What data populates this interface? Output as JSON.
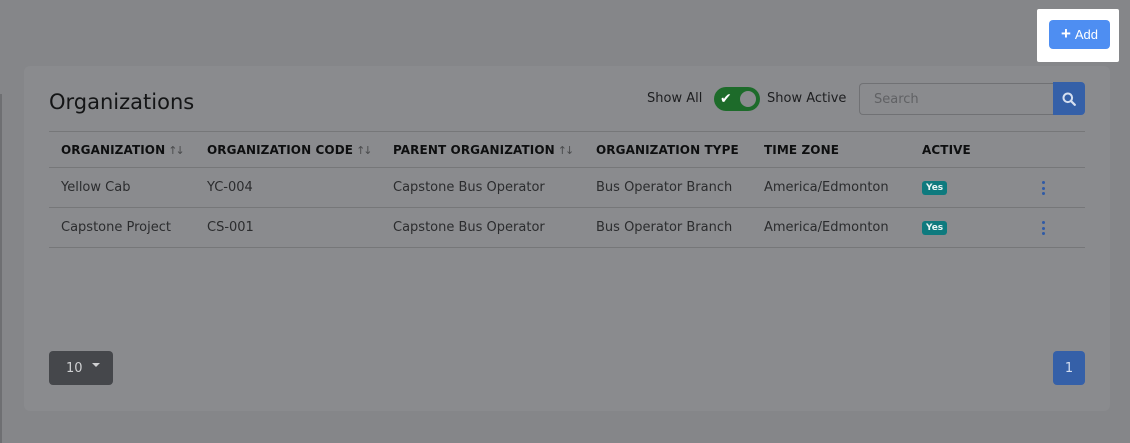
{
  "header": {
    "add_label": "Add",
    "add_icon": "plus-icon"
  },
  "card": {
    "title": "Organizations",
    "show_all_label": "Show All",
    "show_active_label": "Show Active",
    "toggle_on": true,
    "search_placeholder": "Search",
    "search_value": ""
  },
  "table": {
    "columns": [
      {
        "label": "ORGANIZATION",
        "sortable": true
      },
      {
        "label": "ORGANIZATION CODE",
        "sortable": true
      },
      {
        "label": "PARENT ORGANIZATION",
        "sortable": true
      },
      {
        "label": "ORGANIZATION TYPE",
        "sortable": false
      },
      {
        "label": "TIME ZONE",
        "sortable": false
      },
      {
        "label": "ACTIVE",
        "sortable": false
      }
    ],
    "sort_glyph": "↑↓",
    "rows": [
      {
        "organization": "Yellow Cab",
        "code": "YC-004",
        "parent": "Capstone Bus Operator",
        "type": "Bus Operator Branch",
        "timezone": "America/Edmonton",
        "active": "Yes"
      },
      {
        "organization": "Capstone Project",
        "code": "CS-001",
        "parent": "Capstone Bus Operator",
        "type": "Bus Operator Branch",
        "timezone": "America/Edmonton",
        "active": "Yes"
      }
    ]
  },
  "footer": {
    "page_size": "10",
    "current_page": "1"
  },
  "colors": {
    "add_button": "#4e8ef2",
    "toggle_active": "#1d6b2a",
    "active_badge": "#0e7a7e",
    "primary_dark": "#3560a8"
  }
}
